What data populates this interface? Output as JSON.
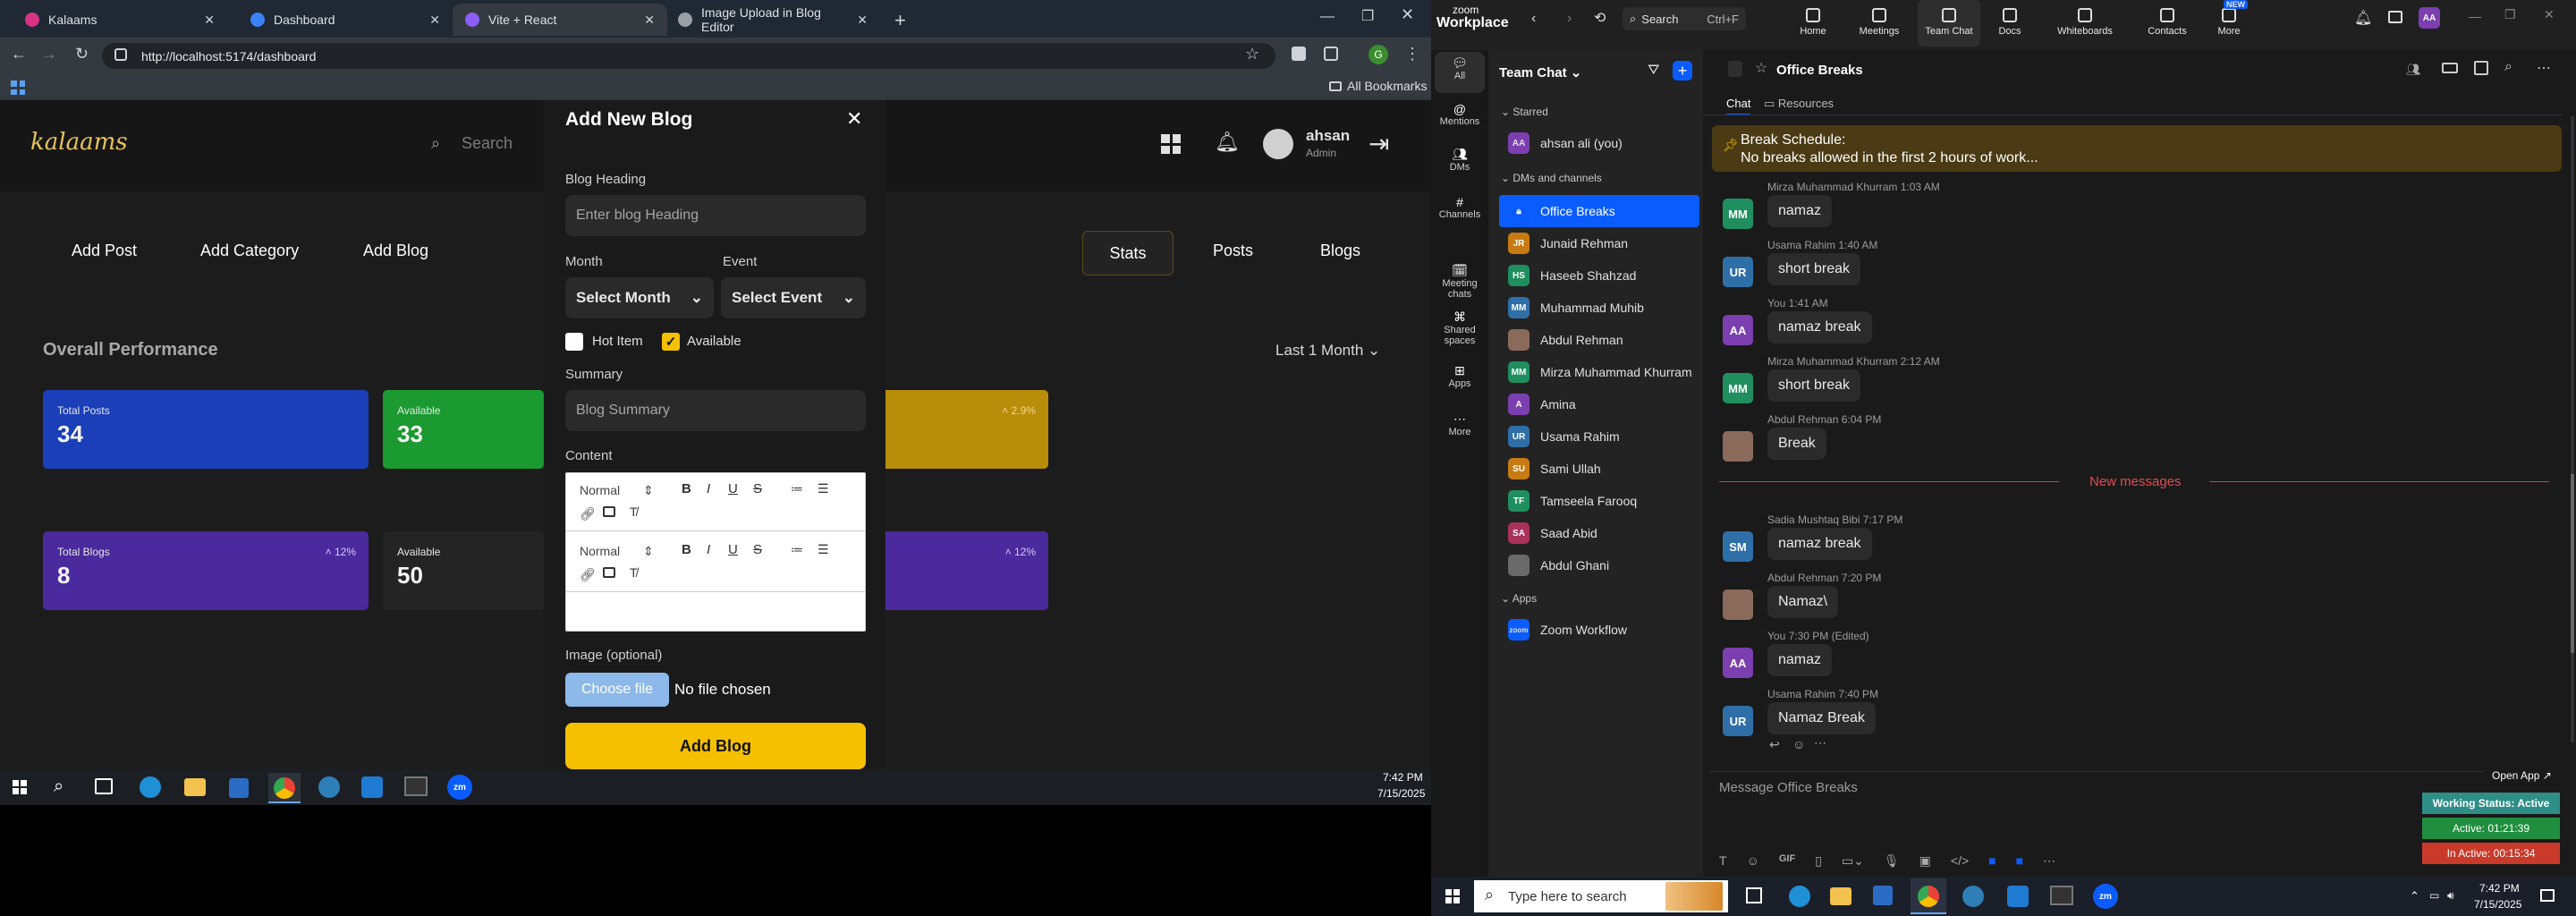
{
  "browser": {
    "tabs": [
      {
        "title": "Kalaams",
        "color": "#d63384"
      },
      {
        "title": "Dashboard",
        "color": "#3b82f6"
      },
      {
        "title": "Vite + React",
        "color": "#8b5cf6"
      },
      {
        "title": "Image Upload in Blog Editor",
        "color": "#9aa0a6"
      }
    ],
    "url": "http://localhost:5174/dashboard",
    "bookmarks_label": "All Bookmarks",
    "profile_initial": "G"
  },
  "site": {
    "logo": "kalaams",
    "search_placeholder": "Search",
    "user_name": "ahsan",
    "user_role": "Admin",
    "nav": [
      "Add Post",
      "Add Category",
      "Add Blog"
    ],
    "right_tabs": [
      "Stats",
      "Posts",
      "Blogs"
    ],
    "section_title": "Overall Performance",
    "period": "Last 1 Month",
    "cards_row1": [
      {
        "label": "Total Posts",
        "value": "34",
        "change": "",
        "color": "#1a3fb8"
      },
      {
        "label": "Available",
        "value": "33",
        "change": "",
        "color": "#1a9a30"
      },
      {
        "label": "",
        "value": "",
        "change": "˄ 2.9%",
        "color": "#b88d0a"
      }
    ],
    "cards_row2": [
      {
        "label": "Total Blogs",
        "value": "8",
        "change": "˄ 12%",
        "color": "#4a2a9c"
      },
      {
        "label": "Available",
        "value": "50",
        "change": "",
        "color": "#1d1d1d"
      },
      {
        "label": "",
        "value": "",
        "change": "˄ 12%",
        "color": "#4a2a9c"
      }
    ]
  },
  "modal": {
    "title": "Add New Blog",
    "heading_label": "Blog Heading",
    "heading_placeholder": "Enter blog Heading",
    "month_label": "Month",
    "month_value": "Select Month",
    "event_label": "Event",
    "event_value": "Select Event",
    "hot_label": "Hot Item",
    "hot_checked": false,
    "available_label": "Available",
    "available_checked": true,
    "summary_label": "Summary",
    "summary_placeholder": "Blog Summary",
    "content_label": "Content",
    "toolbar_style": "Normal",
    "image_label": "Image (optional)",
    "choose_file": "Choose file",
    "no_file": "No file chosen",
    "submit": "Add Blog"
  },
  "left_taskbar": {
    "time": "7:42 PM",
    "date": "7/15/2025"
  },
  "zoom": {
    "brand_top": "zoom",
    "brand_bottom": "Workplace",
    "search_label": "Search",
    "search_shortcut": "Ctrl+F",
    "top_nav": [
      {
        "label": "Home",
        "badge": ""
      },
      {
        "label": "Meetings",
        "badge": ""
      },
      {
        "label": "Team Chat",
        "badge": ""
      },
      {
        "label": "Docs",
        "badge": ""
      },
      {
        "label": "Whiteboards",
        "badge": ""
      },
      {
        "label": "Contacts",
        "badge": ""
      },
      {
        "label": "More",
        "badge": "NEW"
      }
    ],
    "avatar": "AA",
    "rail": [
      "All",
      "Mentions",
      "DMs",
      "Channels",
      "Meeting chats",
      "Shared spaces",
      "Apps",
      "More"
    ],
    "sidebar_title": "Team Chat",
    "starred_label": "Starred",
    "self_item": "ahsan ali (you)",
    "dms_label": "DMs and channels",
    "dms": [
      {
        "name": "Office Breaks",
        "initials": "",
        "color": "#0b5cff",
        "selected": true
      },
      {
        "name": "Junaid Rehman",
        "initials": "JR",
        "color": "#c77b12",
        "selected": false
      },
      {
        "name": "Haseeb Shahzad",
        "initials": "HS",
        "color": "#1f8f5f",
        "selected": false
      },
      {
        "name": "Muhammad Muhib",
        "initials": "MM",
        "color": "#2f6fa8",
        "selected": false
      },
      {
        "name": "Abdul Rehman",
        "initials": "",
        "color": "#8a6a5a",
        "selected": false
      },
      {
        "name": "Mirza Muhammad Khurram",
        "initials": "MM",
        "color": "#1f8f5f",
        "selected": false
      },
      {
        "name": "Amina",
        "initials": "A",
        "color": "#7b3fb0",
        "selected": false
      },
      {
        "name": "Usama Rahim",
        "initials": "UR",
        "color": "#2f6fa8",
        "selected": false
      },
      {
        "name": "Sami Ullah",
        "initials": "SU",
        "color": "#c77b12",
        "selected": false
      },
      {
        "name": "Tamseela Farooq",
        "initials": "TF",
        "color": "#1f8f5f",
        "selected": false
      },
      {
        "name": "Saad Abid",
        "initials": "SA",
        "color": "#a8325a",
        "selected": false
      },
      {
        "name": "Abdul Ghani",
        "initials": "",
        "color": "#6a6a6a",
        "selected": false
      }
    ],
    "apps_label": "Apps",
    "apps": [
      {
        "name": "Zoom Workflow"
      }
    ],
    "channel_title": "Office Breaks",
    "chat_tab": "Chat",
    "resources_tab": "Resources",
    "pinned_title": "Break Schedule:",
    "pinned_text": "No breaks allowed in the first 2 hours of work...",
    "messages": [
      {
        "sender": "Mirza Muhammad Khurram 1:03 AM",
        "text": "namaz",
        "initials": "MM",
        "color": "#1f8f5f"
      },
      {
        "sender": "Usama Rahim 1:40 AM",
        "text": "short break",
        "initials": "UR",
        "color": "#2f6fa8"
      },
      {
        "sender": "You 1:41 AM",
        "text": "namaz break",
        "initials": "AA",
        "color": "#7b3fb0"
      },
      {
        "sender": "Mirza Muhammad Khurram 2:12 AM",
        "text": "short break",
        "initials": "MM",
        "color": "#1f8f5f"
      },
      {
        "sender": "Abdul Rehman 6:04 PM",
        "text": "Break",
        "initials": "",
        "color": "#8a6a5a"
      }
    ],
    "new_messages": "New messages",
    "messages_new": [
      {
        "sender": "Sadia Mushtaq Bibi 7:17 PM",
        "text": "namaz break",
        "initials": "SM",
        "color": "#2f6fa8"
      },
      {
        "sender": "Abdul Rehman 7:20 PM",
        "text": "Namaz\\",
        "initials": "",
        "color": "#8a6a5a"
      },
      {
        "sender": "You 7:30 PM (Edited)",
        "text": "namaz",
        "initials": "AA",
        "color": "#7b3fb0"
      },
      {
        "sender": "Usama Rahim 7:40 PM",
        "text": "Namaz Break",
        "initials": "UR",
        "color": "#2f6fa8"
      }
    ],
    "open_app": "Open App ↗",
    "input_placeholder": "Message Office Breaks",
    "status_working": "Working Status: Active",
    "status_active": "Active: 01:21:39",
    "status_inactive": "In Active: 00:15:34"
  },
  "right_taskbar": {
    "search_placeholder": "Type here to search",
    "time": "7:42 PM",
    "date": "7/15/2025"
  }
}
